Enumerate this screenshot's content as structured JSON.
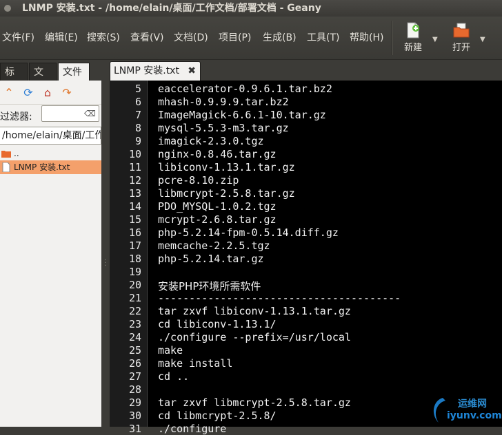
{
  "window": {
    "title": "LNMP 安装.txt - /home/elain/桌面/工作文档/部署文档 - Geany"
  },
  "menu": [
    "文件(F)",
    "编辑(E)",
    "搜索(S)",
    "查看(V)",
    "文档(D)",
    "项目(P)",
    "生成(B)",
    "工具(T)",
    "帮助(H)"
  ],
  "toolbar": {
    "new_label": "新建",
    "open_label": "打开"
  },
  "sidebar": {
    "tabs": [
      "标记",
      "文档",
      "文件"
    ],
    "filter_label": "过滤器:",
    "filter_value": "",
    "path": "/home/elain/桌面/工作文档",
    "files": [
      {
        "name": "..",
        "icon": "folder-icon",
        "selected": false
      },
      {
        "name": "LNMP 安装.txt",
        "icon": "file-icon",
        "selected": true
      }
    ]
  },
  "editor": {
    "tab_label": "LNMP 安装.txt",
    "lines": [
      {
        "n": "5",
        "t": "eaccelerator-0.9.6.1.tar.bz2"
      },
      {
        "n": "6",
        "t": "mhash-0.9.9.9.tar.bz2"
      },
      {
        "n": "7",
        "t": "ImageMagick-6.6.1-10.tar.gz"
      },
      {
        "n": "8",
        "t": "mysql-5.5.3-m3.tar.gz"
      },
      {
        "n": "9",
        "t": "imagick-2.3.0.tgz"
      },
      {
        "n": "10",
        "t": "nginx-0.8.46.tar.gz"
      },
      {
        "n": "11",
        "t": "libiconv-1.13.1.tar.gz"
      },
      {
        "n": "12",
        "t": "pcre-8.10.zip"
      },
      {
        "n": "13",
        "t": "libmcrypt-2.5.8.tar.gz"
      },
      {
        "n": "14",
        "t": "PDO_MYSQL-1.0.2.tgz"
      },
      {
        "n": "15",
        "t": "mcrypt-2.6.8.tar.gz"
      },
      {
        "n": "16",
        "t": "php-5.2.14-fpm-0.5.14.diff.gz"
      },
      {
        "n": "17",
        "t": "memcache-2.2.5.tgz"
      },
      {
        "n": "18",
        "t": "php-5.2.14.tar.gz"
      },
      {
        "n": "19",
        "t": ""
      },
      {
        "n": "20",
        "t": "安装PHP环境所需软件"
      },
      {
        "n": "21",
        "t": "---------------------------------------"
      },
      {
        "n": "22",
        "t": "tar zxvf libiconv-1.13.1.tar.gz"
      },
      {
        "n": "23",
        "t": "cd libiconv-1.13.1/"
      },
      {
        "n": "24",
        "t": "./configure --prefix=/usr/local"
      },
      {
        "n": "25",
        "t": "make"
      },
      {
        "n": "26",
        "t": "make install"
      },
      {
        "n": "27",
        "t": "cd .."
      },
      {
        "n": "28",
        "t": ""
      },
      {
        "n": "29",
        "t": "tar zxvf libmcrypt-2.5.8.tar.gz"
      },
      {
        "n": "30",
        "t": "cd libmcrypt-2.5.8/"
      },
      {
        "n": "31",
        "t": "./configure"
      }
    ]
  },
  "watermark": {
    "line1": "运维网",
    "line2": "iyunv.com"
  }
}
